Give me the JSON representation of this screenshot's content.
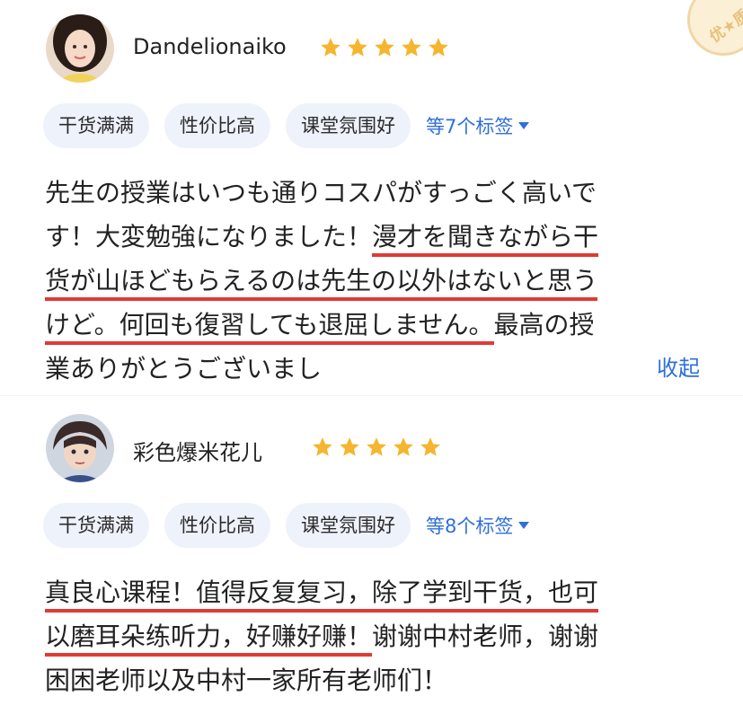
{
  "badge": {
    "label": "优★质"
  },
  "reviews": [
    {
      "user": "Dandelionaiko",
      "rating": 5,
      "tags": [
        "干货满满",
        "性价比高",
        "课堂氛围好"
      ],
      "more_tags": "等7个标签",
      "lines": [
        {
          "plain": "先生の授業はいつも通りコスパがすっごく高いで",
          "hl": ""
        },
        {
          "plain": "す！大変勉強になりました！",
          "hl": "漫才を聞きながら干"
        },
        {
          "plain": "",
          "hl": "货が山ほどもらえるのは先生の以外はないと思う"
        },
        {
          "plain": "",
          "hl": "けど。何回も復習しても退屈しません。",
          "tail": "最高の授"
        },
        {
          "plain": "業ありがとうございまし",
          "hl": ""
        }
      ],
      "collapse_label": "收起"
    },
    {
      "user": "彩色爆米花儿",
      "rating": 5,
      "tags": [
        "干货满满",
        "性价比高",
        "课堂氛围好"
      ],
      "more_tags": "等8个标签",
      "lines": [
        {
          "plain": "",
          "hl": "真良心课程！值得反复复习，除了学到干货，也可"
        },
        {
          "plain": "",
          "hl": "以磨耳朵练听力，好赚好赚！",
          "tail": "谢谢中村老师，谢谢"
        },
        {
          "plain": "困困老师以及中村一家所有老师们！",
          "hl": ""
        }
      ]
    }
  ],
  "colors": {
    "accent": "#2f6fd8",
    "underline": "#e03a34",
    "tag_bg": "#eef2fa",
    "star": "#f5b52e"
  }
}
